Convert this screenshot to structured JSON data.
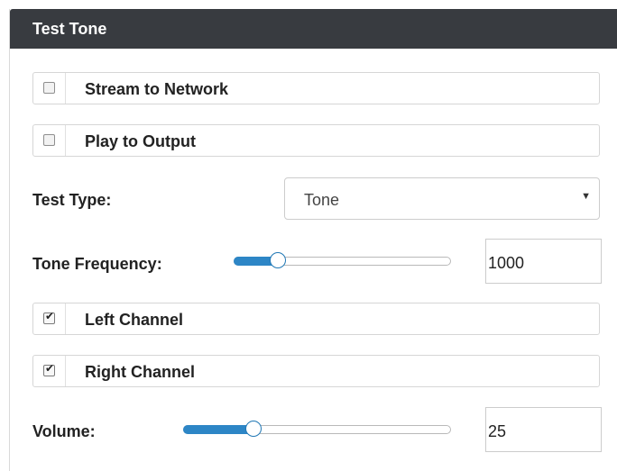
{
  "panel": {
    "title": "Test Tone"
  },
  "stream_to_network": {
    "label": "Stream to Network",
    "checked": false
  },
  "play_to_output": {
    "label": "Play to Output",
    "checked": false
  },
  "test_type": {
    "label": "Test Type:",
    "selected": "Tone"
  },
  "tone_frequency": {
    "label": "Tone Frequency:",
    "value": "1000",
    "slider_fraction": 0.19
  },
  "left_channel": {
    "label": "Left Channel",
    "checked": true
  },
  "right_channel": {
    "label": "Right Channel",
    "checked": true
  },
  "volume": {
    "label": "Volume:",
    "value": "25",
    "slider_fraction": 0.25
  },
  "colors": {
    "header_bg": "#383b40",
    "slider_accent": "#2d86c6"
  },
  "icons": {
    "checkmark": "check-icon",
    "dropdown": "caret-down-icon"
  }
}
